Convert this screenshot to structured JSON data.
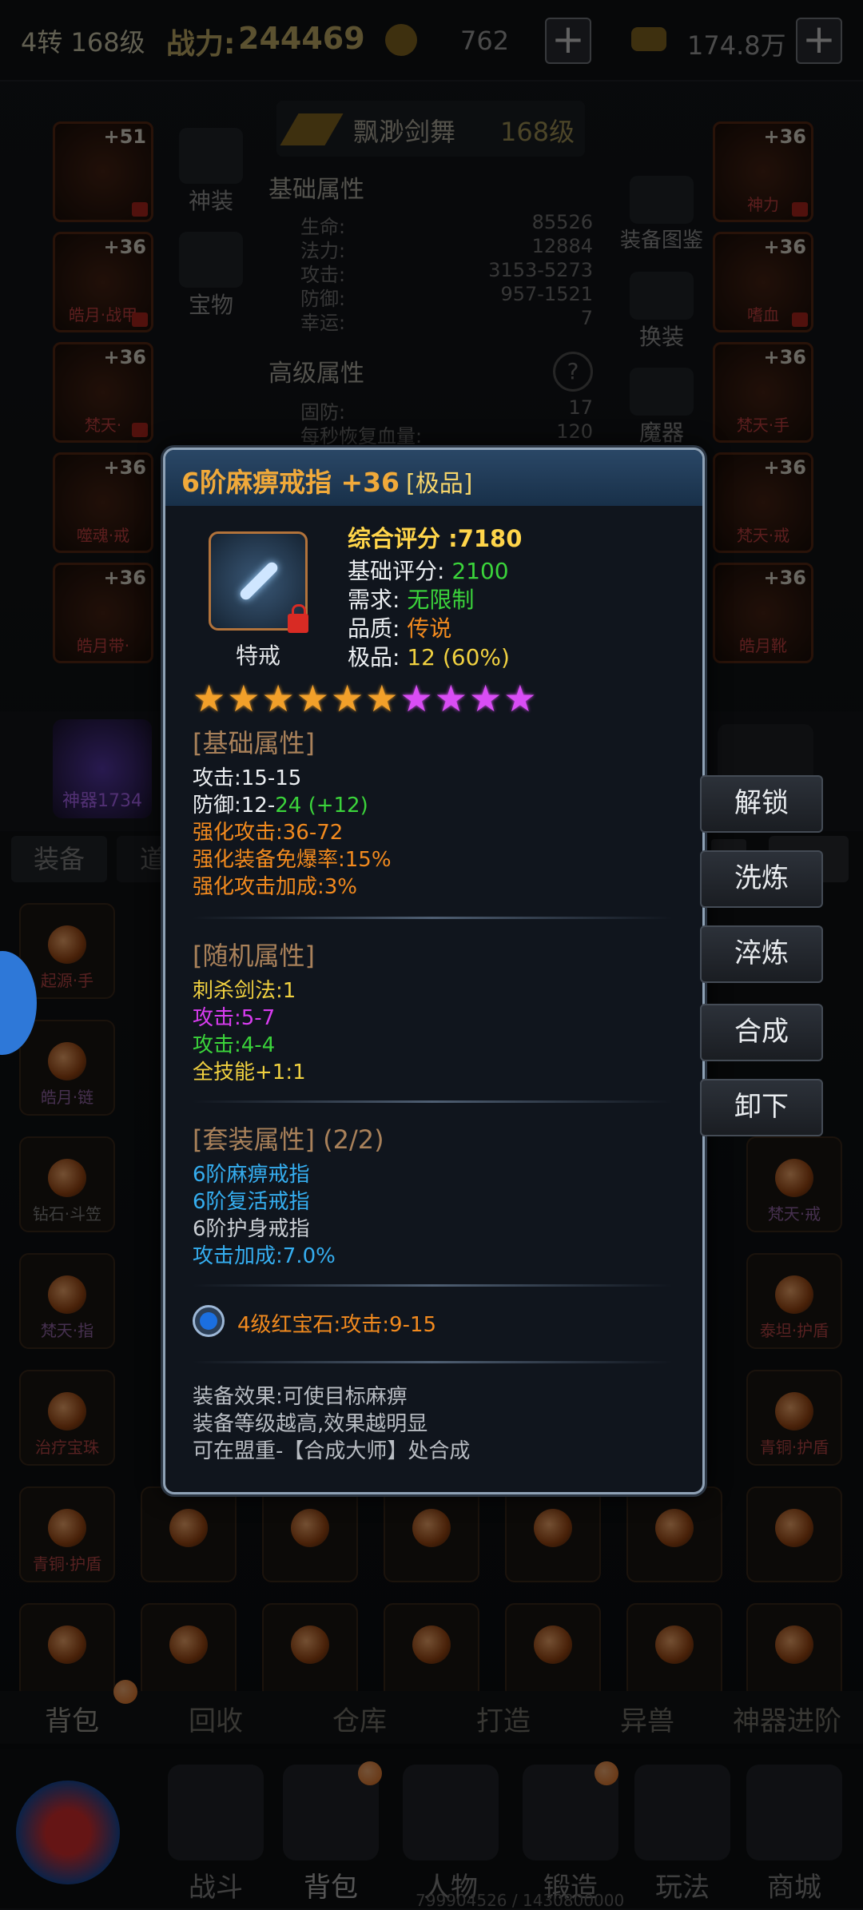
{
  "topbar": {
    "level": "4转 168级",
    "power_label": "战力:",
    "power_value": "244469",
    "coins": "762",
    "gold": "174.8万"
  },
  "equip_panel": {
    "weapon_name": "飘渺剑舞",
    "weapon_level": "168级",
    "base_header": "基础属性",
    "base_attrs": [
      {
        "label": "生命:",
        "value": "85526"
      },
      {
        "label": "法力:",
        "value": "12884"
      },
      {
        "label": "攻击:",
        "value": "3153-5273"
      },
      {
        "label": "防御:",
        "value": "957-1521"
      },
      {
        "label": "幸运:",
        "value": "7"
      }
    ],
    "adv_header": "高级属性",
    "adv_attrs": [
      {
        "label": "固防:",
        "value": "17"
      },
      {
        "label": "每秒恢复血量:",
        "value": "120"
      }
    ],
    "left_buttons": [
      "神装",
      "宝物"
    ],
    "right_buttons": [
      "装备图鉴",
      "换装",
      "魔器"
    ],
    "left_slots": [
      {
        "level": "+51",
        "name": ""
      },
      {
        "level": "+36",
        "name": "皓月·战甲"
      },
      {
        "level": "+36",
        "name": "梵天·"
      },
      {
        "level": "+36",
        "name": "噬魂·戒"
      },
      {
        "level": "+36",
        "name": "皓月带·"
      }
    ],
    "right_slots": [
      {
        "level": "+36",
        "name": "神力"
      },
      {
        "level": "+36",
        "name": "嗜血"
      },
      {
        "level": "+36",
        "name": "梵天·手"
      },
      {
        "level": "+36",
        "name": "梵天·戒"
      },
      {
        "level": "+36",
        "name": "皓月靴"
      }
    ],
    "god_weapon": "神器1734"
  },
  "inventory": {
    "tabs": [
      "装备",
      "道"
    ],
    "left_items": [
      "起源·手",
      "皓月·链",
      "钻石·斗笠",
      "梵天·指",
      "治疗宝珠",
      "青铜·护盾"
    ],
    "right_items": [
      "梵天·戒",
      "泰坦·护盾",
      "青铜·护盾"
    ]
  },
  "side_buttons": [
    "解锁",
    "洗炼",
    "淬炼",
    "合成",
    "卸下"
  ],
  "popup": {
    "title": "6阶麻痹戒指 +36",
    "grade": "[极品]",
    "icon_caption": "特戒",
    "score_label": "综合评分 :",
    "score_value": "7180",
    "base_score_label": "基础评分: ",
    "base_score_value": "2100",
    "require_label": "需求: ",
    "require_value": "无限制",
    "quality_label": "品质: ",
    "quality_value": "传说",
    "premium_label": "极品: ",
    "premium_value": "12 (60%)",
    "stars": {
      "gold": 6,
      "purple": 4
    },
    "base_attr_header": "[基础属性]",
    "base_attrs": {
      "atk": "攻击:15-15",
      "def_prefix": "防御:12-",
      "def_bonus": "24 (+12)",
      "enh_atk": "强化攻击:36-72",
      "enh_burst": "强化装备免爆率:15%",
      "enh_bonus": "强化攻击加成:3%"
    },
    "random_attr_header": "[随机属性]",
    "random_attrs": [
      "刺杀剑法:1",
      "攻击:5-7",
      "攻击:4-4",
      "全技能+1:1"
    ],
    "set_header": "[套装属性]",
    "set_count": "(2/2)",
    "set_items": [
      "6阶麻痹戒指",
      "6阶复活戒指",
      "6阶护身戒指"
    ],
    "set_bonus": "攻击加成:7.0%",
    "gem_text": "4级红宝石:攻击:9-15",
    "effects": [
      "装备效果:可使目标麻痹",
      "装备等级越高,效果越明显",
      "可在盟重-【合成大师】处合成"
    ]
  },
  "bottom_tabs": [
    "背包",
    "回收",
    "仓库",
    "打造",
    "异兽",
    "神器进阶"
  ],
  "nav": [
    "战斗",
    "背包",
    "人物",
    "锻造",
    "玩法",
    "商城"
  ],
  "exp_text": "799904526 / 1430800000",
  "colors": {
    "title": "#f0a93a",
    "gold": "#ffd54a",
    "green": "#3bd43b",
    "orange": "#f28a1e",
    "yellow": "#f0d040",
    "purple": "#d83cf0",
    "blue": "#35aef0",
    "gray": "#c9cdd2"
  }
}
